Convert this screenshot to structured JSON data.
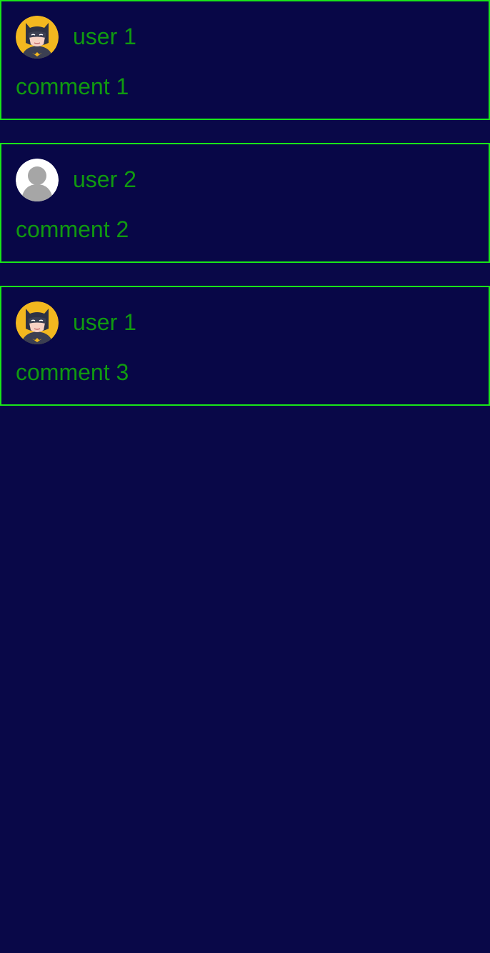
{
  "comments": [
    {
      "user": "user 1",
      "text": "comment 1",
      "avatar_icon": "batman-avatar-icon"
    },
    {
      "user": "user 2",
      "text": "comment 2",
      "avatar_icon": "default-user-avatar-icon"
    },
    {
      "user": "user 1",
      "text": "comment 3",
      "avatar_icon": "batman-avatar-icon"
    }
  ],
  "colors": {
    "background": "#090848",
    "card_border": "#19e619",
    "text": "#109a10"
  }
}
